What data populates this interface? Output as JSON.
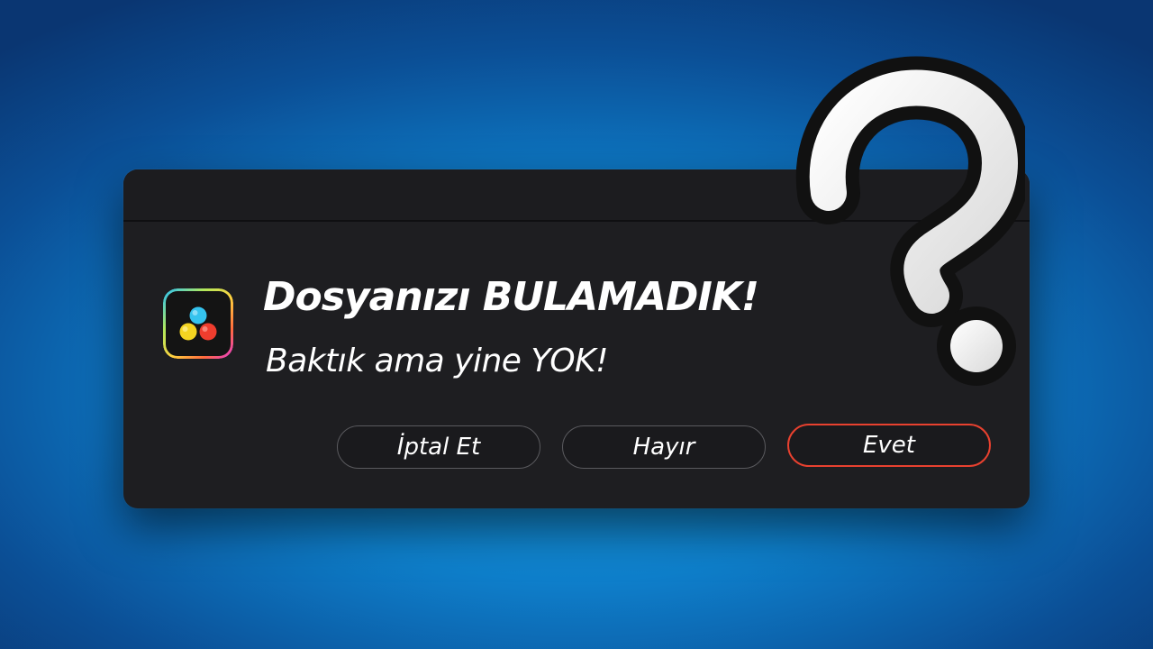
{
  "dialog": {
    "app_icon": "davinci-resolve-icon",
    "title": "Dosyanızı BULAMADIK!",
    "message": "Baktık ama yine YOK!",
    "buttons": {
      "cancel_label": "İptal Et",
      "no_label": "Hayır",
      "yes_label": "Evet"
    }
  },
  "decoration": {
    "icon": "question-mark-icon"
  },
  "colors": {
    "background": "#0e7fcb",
    "dialog": "#1e1e21",
    "primary_button_border": "#e8412f",
    "button_border": "#5a5a5e",
    "text": "#ffffff"
  }
}
